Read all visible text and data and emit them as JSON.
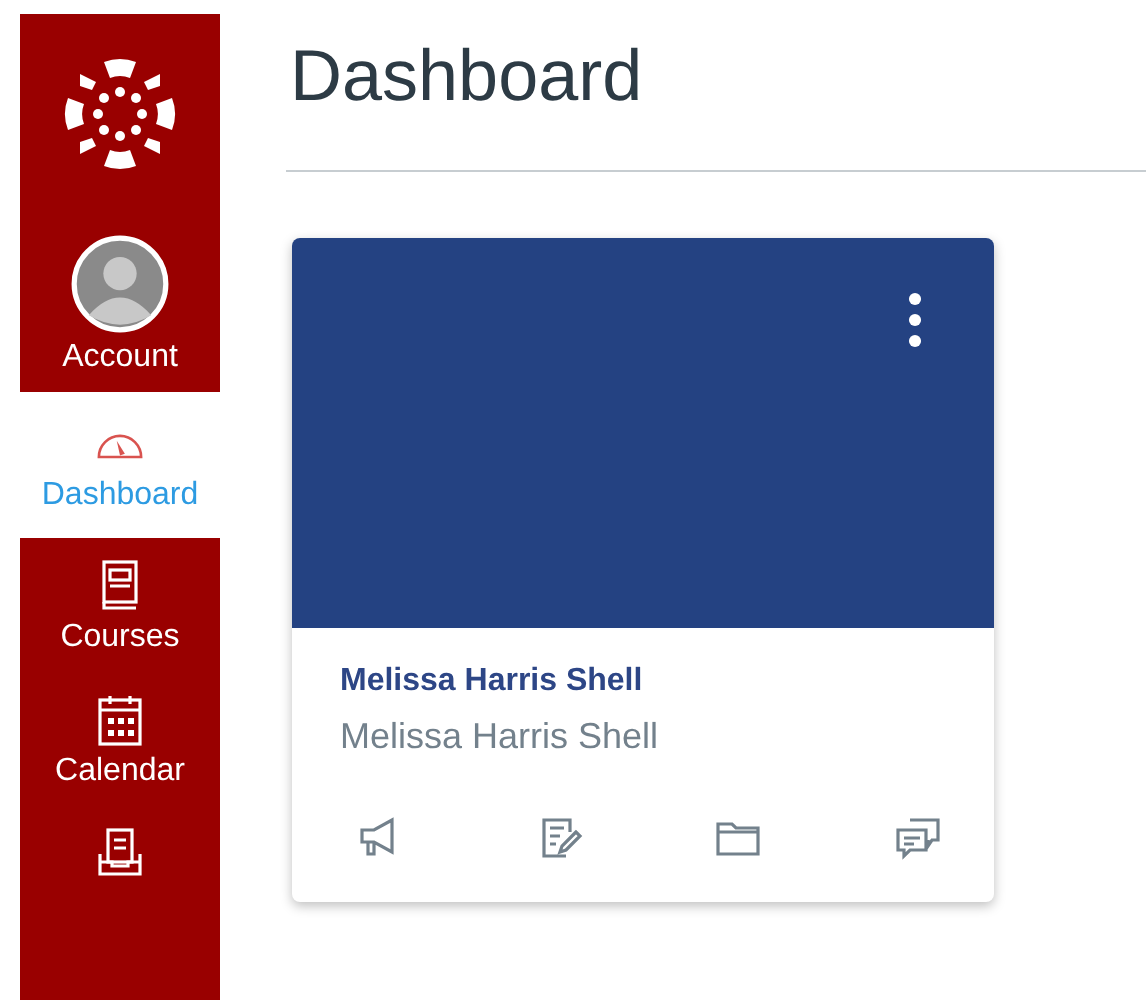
{
  "nav": [
    {
      "label": "Account",
      "kind": "avatar",
      "selected": false
    },
    {
      "label": "Dashboard",
      "kind": "gauge",
      "selected": true
    },
    {
      "label": "Courses",
      "kind": "book",
      "selected": false
    },
    {
      "label": "Calendar",
      "kind": "calendar",
      "selected": false
    },
    {
      "kind": "inbox",
      "selected": false
    }
  ],
  "page_title": "Dashboard",
  "cards": [
    {
      "color": "#244282",
      "title": "Melissa Harris Shell",
      "subtitle": "Melissa Harris Shell",
      "actions": [
        {
          "kind": "announcement"
        },
        {
          "kind": "assignment"
        },
        {
          "kind": "folder"
        },
        {
          "kind": "discussion"
        }
      ]
    }
  ]
}
